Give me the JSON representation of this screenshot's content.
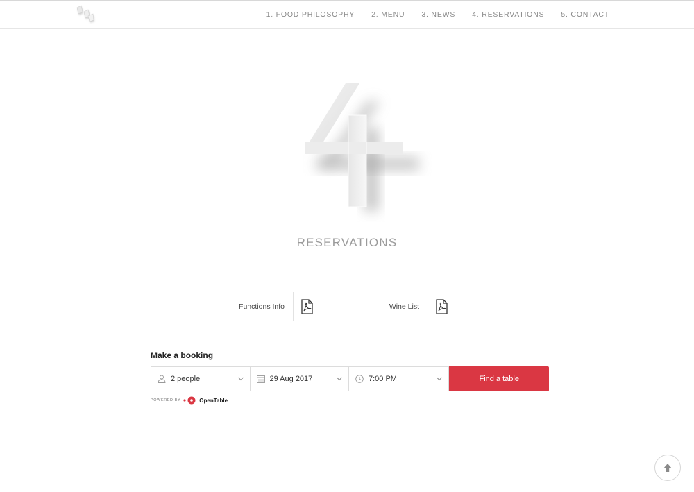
{
  "nav": {
    "items": [
      {
        "label": "1. FOOD PHILOSOPHY"
      },
      {
        "label": "2. MENU"
      },
      {
        "label": "3. NEWS"
      },
      {
        "label": "4. RESERVATIONS"
      },
      {
        "label": "5. CONTACT"
      }
    ]
  },
  "logo": {
    "icon": "restaurant-logo"
  },
  "hero": {
    "icon": "number-4-emboss"
  },
  "section": {
    "title": "RESERVATIONS"
  },
  "downloads": [
    {
      "label": "Functions Info",
      "icon": "pdf-icon"
    },
    {
      "label": "Wine List",
      "icon": "pdf-icon"
    }
  ],
  "booking": {
    "title": "Make a booking",
    "party_size": "2 people",
    "date": "29 Aug 2017",
    "time": "7:00 PM",
    "submit_label": "Find a table",
    "accent": "#da3743"
  },
  "powered": {
    "prefix": "POWERED BY",
    "brand": "OpenTable"
  },
  "back_to_top": {
    "icon": "arrow-up-icon"
  }
}
